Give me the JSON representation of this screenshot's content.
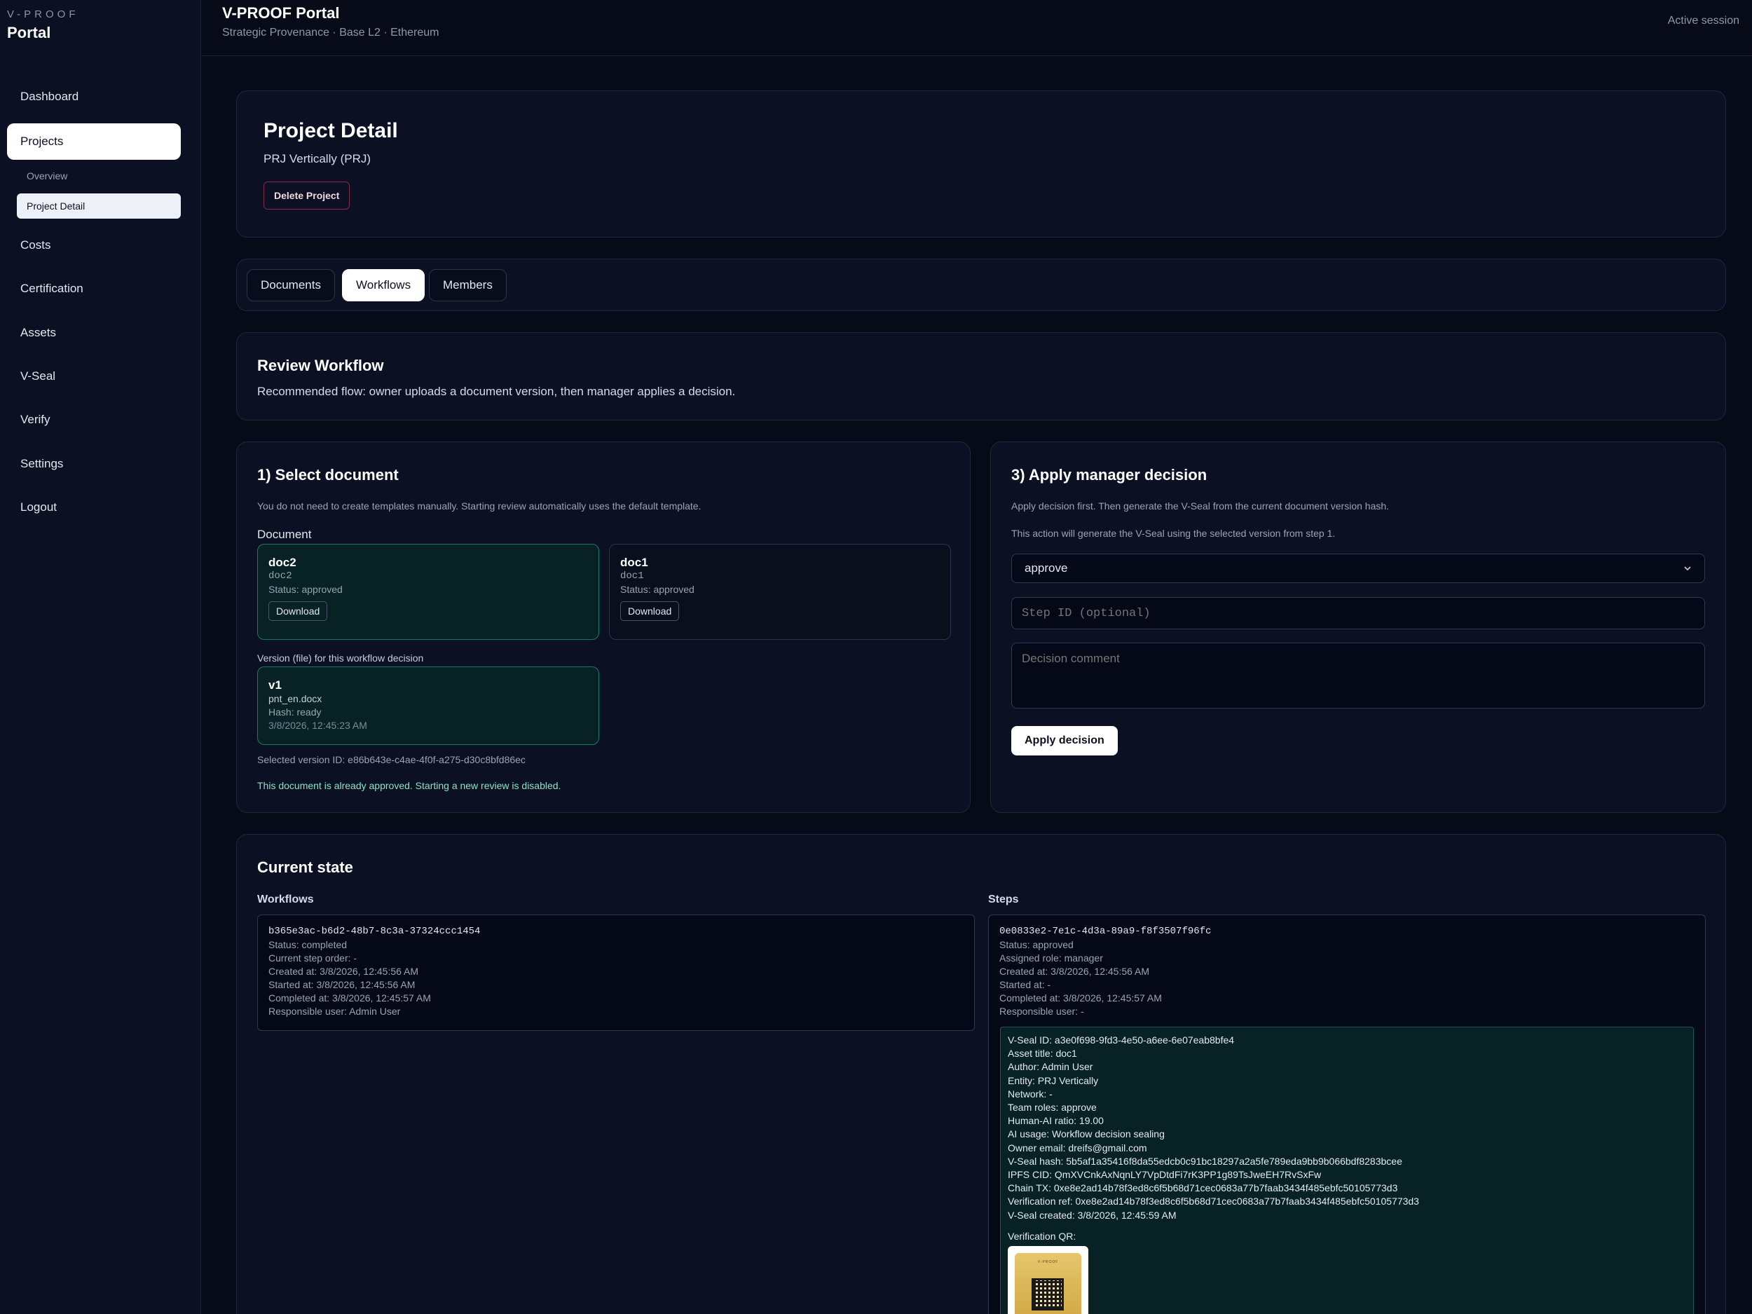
{
  "sidebar": {
    "brand_kicker": "V-PROOF",
    "brand_title": "Portal",
    "items": [
      {
        "label": "Dashboard"
      },
      {
        "label": "Projects"
      },
      {
        "label": "Costs"
      },
      {
        "label": "Certification"
      },
      {
        "label": "Assets"
      },
      {
        "label": "V-Seal"
      },
      {
        "label": "Verify"
      },
      {
        "label": "Settings"
      },
      {
        "label": "Logout"
      }
    ],
    "sub_items": [
      {
        "label": "Overview"
      },
      {
        "label": "Project Detail"
      }
    ]
  },
  "header": {
    "title": "V-PROOF Portal",
    "subtitle": "Strategic Provenance · Base L2 · Ethereum",
    "session": "Active session"
  },
  "project": {
    "heading": "Project Detail",
    "name": "PRJ Vertically (PRJ)",
    "delete_label": "Delete Project"
  },
  "tabs": [
    {
      "label": "Documents"
    },
    {
      "label": "Workflows"
    },
    {
      "label": "Members"
    }
  ],
  "review": {
    "title": "Review Workflow",
    "description": "Recommended flow: owner uploads a document version, then manager applies a decision."
  },
  "select_doc": {
    "title": "1) Select document",
    "note": "You do not need to create templates manually. Starting review automatically uses the default template.",
    "doc_label": "Document",
    "documents": [
      {
        "name": "doc2",
        "slug": "doc2",
        "status": "Status: approved",
        "download": "Download"
      },
      {
        "name": "doc1",
        "slug": "doc1",
        "status": "Status: approved",
        "download": "Download"
      }
    ],
    "version_label": "Version (file) for this workflow decision",
    "version": {
      "name": "v1",
      "file": "pnt_en.docx",
      "hash": "Hash: ready",
      "date": "3/8/2026, 12:45:23 AM"
    },
    "selected_version": "Selected version ID: e86b643e-c4ae-4f0f-a275-d30c8bfd86ec",
    "approved_notice": "This document is already approved. Starting a new review is disabled."
  },
  "decision": {
    "title": "3) Apply manager decision",
    "note1": "Apply decision first. Then generate the V-Seal from the current document version hash.",
    "note2": "This action will generate the V-Seal using the selected version from step 1.",
    "select_value": "approve",
    "step_placeholder": "Step ID (optional)",
    "comment_placeholder": "Decision comment",
    "apply_label": "Apply decision"
  },
  "state": {
    "title": "Current state",
    "workflows_label": "Workflows",
    "steps_label": "Steps",
    "workflow": {
      "id": "b365e3ac-b6d2-48b7-8c3a-37324ccc1454",
      "lines": [
        "Status: completed",
        "Current step order: -",
        "Created at: 3/8/2026, 12:45:56 AM",
        "Started at: 3/8/2026, 12:45:56 AM",
        "Completed at: 3/8/2026, 12:45:57 AM",
        "Responsible user: Admin User"
      ]
    },
    "step": {
      "id": "0e0833e2-7e1c-4d3a-89a9-f8f3507f96fc",
      "lines": [
        "Status: approved",
        "Assigned role: manager",
        "Created at: 3/8/2026, 12:45:56 AM",
        "Started at: -",
        "Completed at: 3/8/2026, 12:45:57 AM",
        "Responsible user: -"
      ]
    },
    "seal": {
      "lines": [
        "V-Seal ID: a3e0f698-9fd3-4e50-a6ee-6e07eab8bfe4",
        "Asset title: doc1",
        "Author: Admin User",
        "Entity: PRJ Vertically",
        "Network: -",
        "Team roles: approve",
        "Human-AI ratio: 19.00",
        "AI usage: Workflow decision sealing",
        "Owner email: dreifs@gmail.com",
        "V-Seal hash: 5b5af1a35416f8da55edcb0c91bc18297a2a5fe789eda9bb9b066bdf8283bcee",
        "IPFS CID: QmXVCnkAxNqnLY7VpDtdFi7rK3PP1g89TsJweEH7RvSxFw",
        "Chain TX: 0xe8e2ad14b78f3ed8c6f5b68d71cec0683a77b7faab3434f485ebfc50105773d3",
        "Verification ref: 0xe8e2ad14b78f3ed8c6f5b68d71cec0683a77b7faab3434f485ebfc50105773d3",
        "V-Seal created: 3/8/2026, 12:45:59 AM"
      ],
      "qr_label": "Verification QR:",
      "qr_brand": "V-PROOF"
    }
  },
  "icons": {
    "select_chevron": "chevron-down-icon"
  },
  "colors": {
    "background": "#070b17",
    "panel": "#0b1122",
    "accent_teal": "#157a6b",
    "danger": "#8b2846",
    "success_text": "#8fe0c0"
  }
}
